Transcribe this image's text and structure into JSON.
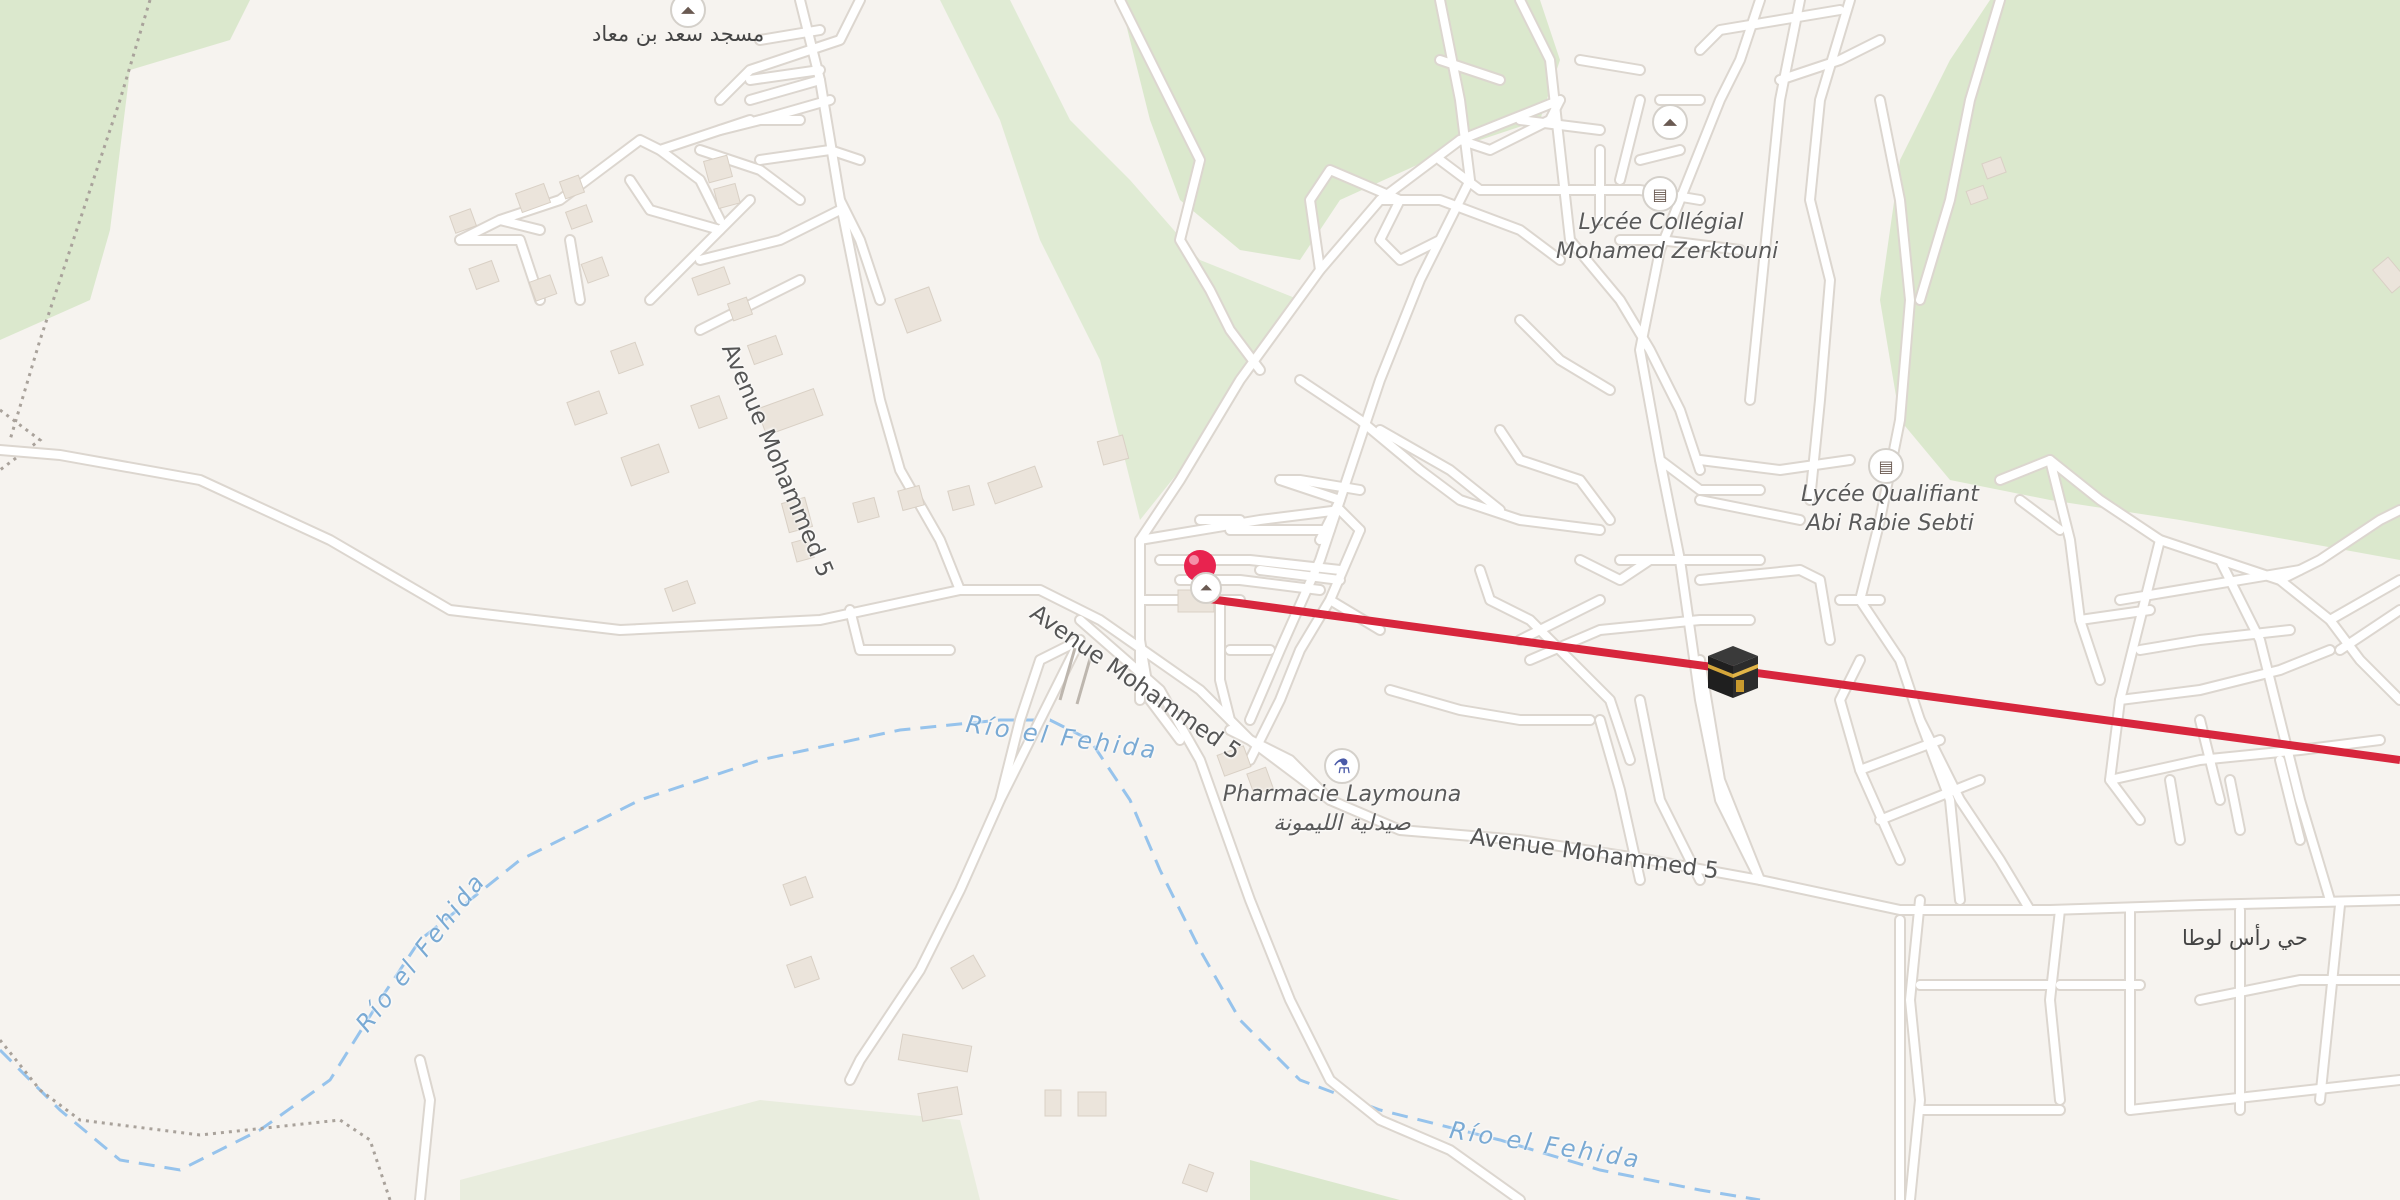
{
  "map": {
    "colors": {
      "background": "#f6f3ef",
      "green": "#dbe8cd",
      "road": "#ffffff",
      "road_casing": "#dcd6cf",
      "building": "#ebe4db",
      "river": "#96c3ec",
      "qibla_line": "#d7263d",
      "pin": "#e8234f"
    },
    "labels": {
      "mosque_saad": "مسجد سعد بن معاد",
      "lycee_zerktouni_1": "Lycée Collégial",
      "lycee_zerktouni_2": "Mohamed Zerktouni",
      "lycee_sebti_1": "Lycée Qualifiant",
      "lycee_sebti_2": "Abi Rabie Sebti",
      "pharmacie_1": "Pharmacie Laymouna",
      "pharmacie_2": "صيدلية الليمونة",
      "avenue_1": "Avenue Mohammed 5",
      "avenue_2": "Avenue Mohammed 5",
      "avenue_3": "Avenue Mohammed 5",
      "river_1": "Río el Fehida",
      "river_2": "Río el Fehida",
      "river_3": "Río el Fehida",
      "district": "حي رأس لوطا"
    },
    "icons": {
      "mosque_top": "mosque-icon",
      "mosque_right": "mosque-icon",
      "school_zerktouni": "school-icon",
      "school_sebti": "school-icon",
      "pharmacy": "pharmacy-icon",
      "kaaba": "kaaba-icon",
      "location_pin": "location-pin-icon"
    }
  }
}
